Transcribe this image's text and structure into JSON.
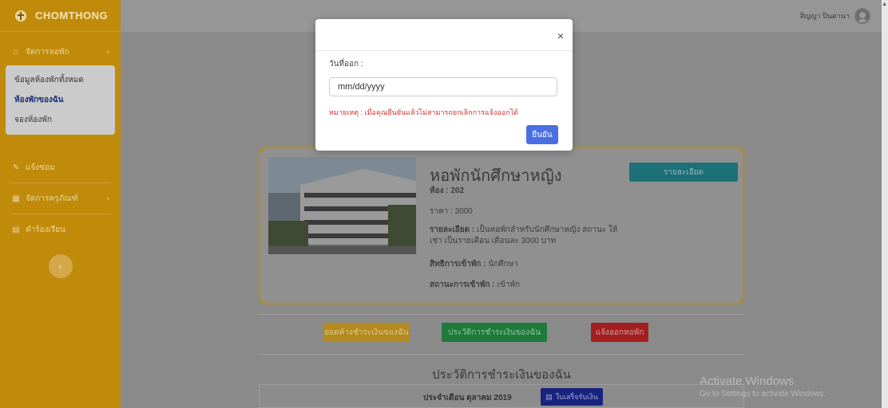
{
  "brand": {
    "name": "CHOMTHONG"
  },
  "sidebar": {
    "items": [
      {
        "icon": "home-icon",
        "label": "จัดการหอพัก",
        "has_children": true
      },
      {
        "icon": "pencil-icon",
        "label": "แจ้งซ่อม",
        "has_children": false
      },
      {
        "icon": "box-icon",
        "label": "จัดการครุภัณฑ์",
        "has_children": true
      },
      {
        "icon": "file-icon",
        "label": "ตำร้องเรียน",
        "has_children": false
      }
    ],
    "submenu": [
      {
        "label": "ข้อมูลห้องพักทั้งหมด"
      },
      {
        "label": "ห้องพักของฉัน",
        "active": true
      },
      {
        "label": "จองห้องพัก"
      }
    ]
  },
  "topbar": {
    "user_name": "สิญญา ปินตานา"
  },
  "room": {
    "title": "หอพักนักศึกษาหญิง",
    "room_label": "ห้อง : 202",
    "price_label": "ราคา : 3000",
    "detail_label": "รายละเอียด :",
    "detail_text": "เป็นหอพักสำหรับนักศึกษาหญิง สถานะ ให้เช่า เป็นรายเดือน เดือนละ 3000 บาท",
    "rights_label": "สิทธิการเข้าพัก :",
    "rights_value": "นักศึกษา",
    "status_label": "สถานะการเข้าพัก :",
    "status_value": "เข้าพัก",
    "detail_button": "รายละเอียด"
  },
  "actions": {
    "outstanding": "ยอดค้างชำระเงินของฉัน",
    "history": "ประวัติการชำระเงินของฉัน",
    "checkout": "แจ้งออกหอพัก"
  },
  "payment_history": {
    "title": "ประวัติการชำระเงินของฉัน",
    "month_label": "ประจำเดือน ตุลาคม 2019",
    "receipt_button": "ใบเสร็จรับเงิน"
  },
  "modal": {
    "field_label": "วันที่ออก :",
    "date_placeholder": "mm/dd/yyyy",
    "warning": "หมายเหตุ : เมื่อคุณยืนยันแล้วไม่สามารถยกเลิกการแจ้งออกได้",
    "confirm": "ยืนยัน",
    "close": "×"
  },
  "watermark": {
    "line1": "Activate Windows",
    "line2": "Go to Settings to activate Windows."
  },
  "colors": {
    "sidebar": "#c08b0b",
    "overlay": "#8a8a8a",
    "detail_button": "#1e7077",
    "outstanding_button": "#b38a1f",
    "history_button": "#1f7a3c",
    "checkout_button": "#a31f1f",
    "receipt_button": "#1a237e",
    "confirm_button": "#4a6fe3",
    "warning_text": "#d32f2f"
  }
}
